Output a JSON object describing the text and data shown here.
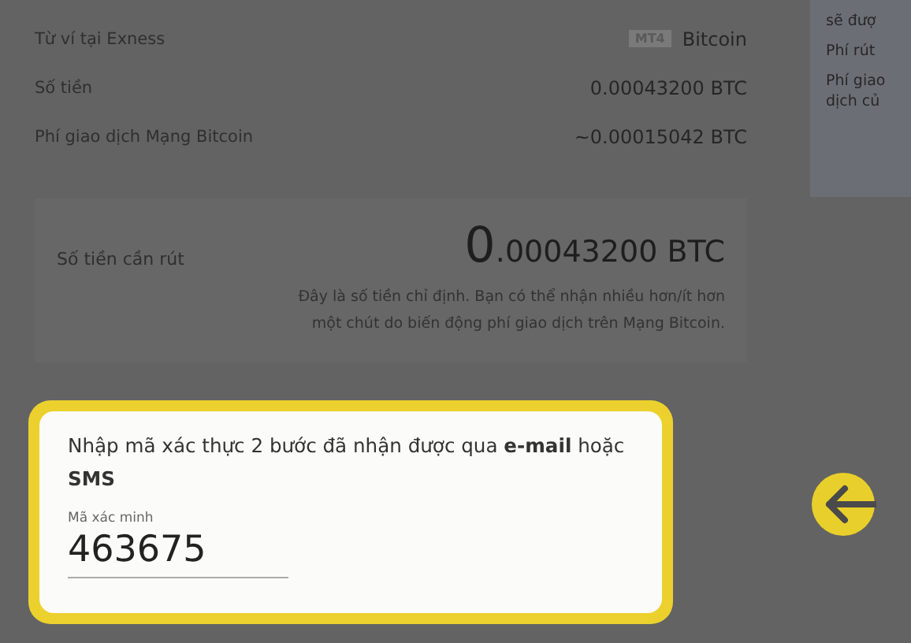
{
  "details": [
    {
      "label": "Từ ví tại Exness",
      "badge": "MT4",
      "value": "Bitcoin"
    },
    {
      "label": "Số tiền",
      "value": "0.00043200 BTC"
    },
    {
      "label": "Phí giao dịch Mạng Bitcoin",
      "value": "~0.00015042 BTC"
    }
  ],
  "withdraw": {
    "label": "Số tiền cần rút",
    "amount_whole": "0",
    "amount_rest": ".00043200 BTC",
    "note": "Đây là số tiền chỉ định. Bạn có thể nhận nhiều hơn/ít hơn một chút do biến động phí giao dịch trên Mạng Bitcoin."
  },
  "side_panel": {
    "lines": [
      "sẽ đượ",
      "Phí rút",
      "Phí giao",
      "dịch củ"
    ]
  },
  "verification": {
    "prompt": "Nhập mã xác thực 2 bước đã nhận được qua **e-mail** hoặc **SMS**",
    "field_label": "Mã xác minh",
    "value": "463675"
  }
}
